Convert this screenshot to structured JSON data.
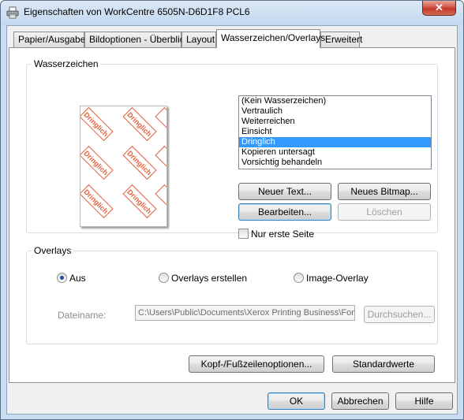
{
  "window": {
    "title": "Eigenschaften von WorkCentre 6505N-D6D1F8 PCL6",
    "close_label": "✕"
  },
  "tabs": [
    {
      "label": "Papier/Ausgabe"
    },
    {
      "label": "Bildoptionen - Überblick"
    },
    {
      "label": "Layout"
    },
    {
      "label": "Wasserzeichen/Overlays",
      "active": true
    },
    {
      "label": "Erweitert"
    }
  ],
  "watermark": {
    "group_title": "Wasserzeichen",
    "preview_stamp": "Dringlich",
    "list": [
      "(Kein Wasserzeichen)",
      "Vertraulich",
      "Weiterreichen",
      "Einsicht",
      "Dringlich",
      "Kopieren untersagt",
      "Vorsichtig behandeln"
    ],
    "selected": "Dringlich",
    "buttons": {
      "new_text": "Neuer Text...",
      "new_bitmap": "Neues Bitmap...",
      "edit": "Bearbeiten...",
      "delete": "Löschen"
    },
    "first_page_only": {
      "label": "Nur erste Seite",
      "checked": false
    }
  },
  "overlays": {
    "group_title": "Overlays",
    "options": [
      {
        "label": "Aus",
        "selected": true
      },
      {
        "label": "Overlays erstellen",
        "selected": false
      },
      {
        "label": "Image-Overlay",
        "selected": false
      }
    ],
    "filename_label": "Dateiname:",
    "filename_value": "C:\\Users\\Public\\Documents\\Xerox Printing Business\\Forr",
    "browse": "Durchsuchen..."
  },
  "footer_buttons": {
    "header_footer": "Kopf-/Fußzeilenoptionen...",
    "defaults": "Standardwerte"
  },
  "dialog_buttons": {
    "ok": "OK",
    "cancel": "Abbrechen",
    "help": "Hilfe"
  },
  "colors": {
    "stamp": "#e0603c",
    "selection": "#3399ff",
    "close": "#c23a2c"
  }
}
